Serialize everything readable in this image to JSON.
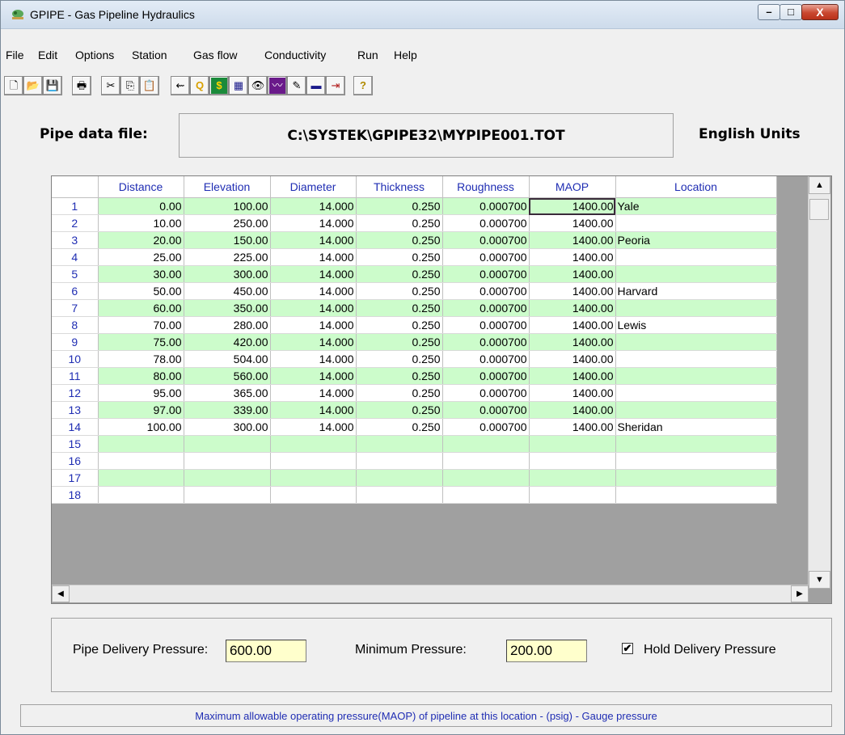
{
  "window": {
    "title": "GPIPE - Gas Pipeline Hydraulics",
    "minimize": "–",
    "maximize": "□",
    "close": "X"
  },
  "menu": [
    "File",
    "Edit",
    "Options",
    "Station",
    "Gas flow",
    "Conductivity",
    "Run",
    "Help"
  ],
  "toolbar": {
    "new": "🗋",
    "open": "📂",
    "save": "💾",
    "print": "🖶",
    "cut": "✂",
    "copy": "⎘",
    "paste": "📋",
    "pipe": "⇜",
    "run": "Q",
    "cost": "$",
    "calc": "▦",
    "view": "👁",
    "graph": "〰",
    "notes": "✎",
    "report": "▬",
    "exit": "⇥",
    "help": "?"
  },
  "header": {
    "label": "Pipe data file:",
    "file_path": "C:\\SYSTEK\\GPIPE32\\MYPIPE001.TOT",
    "units": "English Units"
  },
  "grid": {
    "columns": [
      "Distance",
      "Elevation",
      "Diameter",
      "Thickness",
      "Roughness",
      "MAOP",
      "Location"
    ],
    "rows": [
      {
        "n": "1",
        "dist": "0.00",
        "elev": "100.00",
        "dia": "14.000",
        "thk": "0.250",
        "rough": "0.000700",
        "maop": "1400.00",
        "loc": "Yale"
      },
      {
        "n": "2",
        "dist": "10.00",
        "elev": "250.00",
        "dia": "14.000",
        "thk": "0.250",
        "rough": "0.000700",
        "maop": "1400.00",
        "loc": ""
      },
      {
        "n": "3",
        "dist": "20.00",
        "elev": "150.00",
        "dia": "14.000",
        "thk": "0.250",
        "rough": "0.000700",
        "maop": "1400.00",
        "loc": "Peoria"
      },
      {
        "n": "4",
        "dist": "25.00",
        "elev": "225.00",
        "dia": "14.000",
        "thk": "0.250",
        "rough": "0.000700",
        "maop": "1400.00",
        "loc": ""
      },
      {
        "n": "5",
        "dist": "30.00",
        "elev": "300.00",
        "dia": "14.000",
        "thk": "0.250",
        "rough": "0.000700",
        "maop": "1400.00",
        "loc": ""
      },
      {
        "n": "6",
        "dist": "50.00",
        "elev": "450.00",
        "dia": "14.000",
        "thk": "0.250",
        "rough": "0.000700",
        "maop": "1400.00",
        "loc": "Harvard"
      },
      {
        "n": "7",
        "dist": "60.00",
        "elev": "350.00",
        "dia": "14.000",
        "thk": "0.250",
        "rough": "0.000700",
        "maop": "1400.00",
        "loc": ""
      },
      {
        "n": "8",
        "dist": "70.00",
        "elev": "280.00",
        "dia": "14.000",
        "thk": "0.250",
        "rough": "0.000700",
        "maop": "1400.00",
        "loc": "Lewis"
      },
      {
        "n": "9",
        "dist": "75.00",
        "elev": "420.00",
        "dia": "14.000",
        "thk": "0.250",
        "rough": "0.000700",
        "maop": "1400.00",
        "loc": ""
      },
      {
        "n": "10",
        "dist": "78.00",
        "elev": "504.00",
        "dia": "14.000",
        "thk": "0.250",
        "rough": "0.000700",
        "maop": "1400.00",
        "loc": ""
      },
      {
        "n": "11",
        "dist": "80.00",
        "elev": "560.00",
        "dia": "14.000",
        "thk": "0.250",
        "rough": "0.000700",
        "maop": "1400.00",
        "loc": ""
      },
      {
        "n": "12",
        "dist": "95.00",
        "elev": "365.00",
        "dia": "14.000",
        "thk": "0.250",
        "rough": "0.000700",
        "maop": "1400.00",
        "loc": ""
      },
      {
        "n": "13",
        "dist": "97.00",
        "elev": "339.00",
        "dia": "14.000",
        "thk": "0.250",
        "rough": "0.000700",
        "maop": "1400.00",
        "loc": ""
      },
      {
        "n": "14",
        "dist": "100.00",
        "elev": "300.00",
        "dia": "14.000",
        "thk": "0.250",
        "rough": "0.000700",
        "maop": "1400.00",
        "loc": "Sheridan"
      },
      {
        "n": "15",
        "dist": "",
        "elev": "",
        "dia": "",
        "thk": "",
        "rough": "",
        "maop": "",
        "loc": ""
      },
      {
        "n": "16",
        "dist": "",
        "elev": "",
        "dia": "",
        "thk": "",
        "rough": "",
        "maop": "",
        "loc": ""
      },
      {
        "n": "17",
        "dist": "",
        "elev": "",
        "dia": "",
        "thk": "",
        "rough": "",
        "maop": "",
        "loc": ""
      },
      {
        "n": "18",
        "dist": "",
        "elev": "",
        "dia": "",
        "thk": "",
        "rough": "",
        "maop": "",
        "loc": ""
      }
    ]
  },
  "bottom": {
    "delivery_label": "Pipe Delivery Pressure:",
    "delivery_value": "600.00",
    "min_label": "Minimum Pressure:",
    "min_value": "200.00",
    "hold_label": "Hold Delivery Pressure",
    "hold_checked": "✔"
  },
  "status": "Maximum allowable operating pressure(MAOP) of pipeline at this location - (psig)  - Gauge pressure",
  "colors": {
    "row_green": "#ccfccb",
    "header_blue": "#1f2db3",
    "field_yellow": "#ffffcc"
  }
}
